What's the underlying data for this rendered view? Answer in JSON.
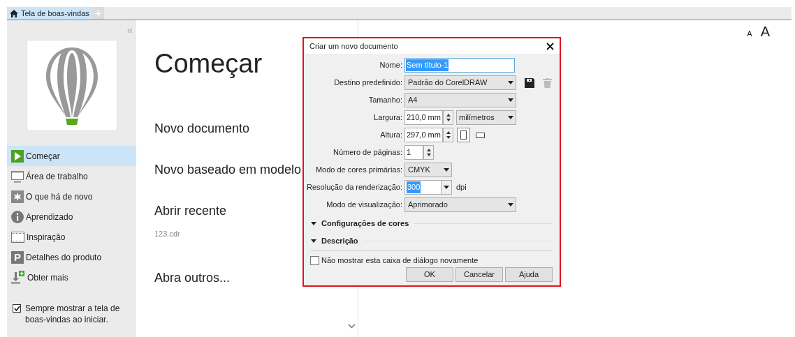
{
  "tabs": [
    {
      "label": "Tela de boas-vindas",
      "selected": true
    }
  ],
  "sidebar": {
    "collapse": "«",
    "items": [
      {
        "label": "Começar",
        "kind": "play",
        "selected": true
      },
      {
        "label": "Área de trabalho",
        "kind": "monitor",
        "selected": false
      },
      {
        "label": "O que há de novo",
        "kind": "star",
        "selected": false
      },
      {
        "label": "Aprendizado",
        "kind": "info",
        "selected": false
      },
      {
        "label": "Inspiração",
        "kind": "film",
        "selected": false
      },
      {
        "label": "Detalhes do produto",
        "kind": "letter",
        "glyph": "P",
        "selected": false
      },
      {
        "label": "Obter mais",
        "kind": "download",
        "selected": false
      }
    ],
    "always_show": {
      "label": "Sempre mostrar a tela de boas-vindas ao iniciar.",
      "checked": true
    }
  },
  "main": {
    "title": "Começar",
    "entries": [
      {
        "kind": "heading",
        "text": "Novo documento"
      },
      {
        "kind": "heading",
        "text": "Novo baseado em modelo"
      },
      {
        "kind": "heading",
        "text": "Abrir recente"
      },
      {
        "kind": "file",
        "text": "123.cdr"
      },
      {
        "kind": "heading",
        "text": "Abra outros..."
      }
    ]
  },
  "font_size": {
    "small": "A",
    "large": "A"
  },
  "dialog": {
    "title": "Criar um novo documento",
    "fields": [
      {
        "label": "Nome:",
        "kind": "text",
        "value": "Sem título-1",
        "text_selected": true
      },
      {
        "label": "Destino predefinido:",
        "kind": "preset",
        "value": "Padrão do CorelDRAW"
      },
      {
        "label": "Tamanho:",
        "kind": "select",
        "value": "A4"
      },
      {
        "label": "Largura:",
        "kind": "width",
        "value": "210,0 mm",
        "unit": "milímetros"
      },
      {
        "label": "Altura:",
        "kind": "height",
        "value": "297,0 mm",
        "orientations": [
          {
            "kind": "portrait",
            "selected": true
          },
          {
            "kind": "landscape",
            "selected": false
          }
        ]
      },
      {
        "label": "Número de páginas:",
        "kind": "pages",
        "value": "1"
      },
      {
        "label": "Modo de cores primárias:",
        "kind": "mode",
        "value": "CMYK"
      },
      {
        "label": "Resolução da renderização:",
        "kind": "resolution",
        "value": "300",
        "text_selected": true,
        "suffix": "dpi"
      },
      {
        "label": "Modo de visualização:",
        "kind": "select",
        "value": "Aprimorado"
      }
    ],
    "sections": [
      "Configurações de cores",
      "Descrição"
    ],
    "dont_show": {
      "label": "Não mostrar esta caixa de diálogo novamente",
      "checked": false
    },
    "buttons": [
      "OK",
      "Cancelar",
      "Ajuda"
    ]
  }
}
